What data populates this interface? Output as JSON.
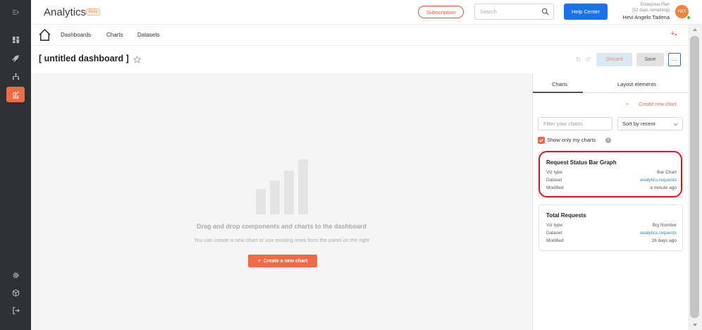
{
  "app": {
    "title": "Analytics",
    "badge": "Beta"
  },
  "header": {
    "subscription_label": "Subscription",
    "search_placeholder": "Search",
    "help_label": "Help Center",
    "plan_name": "Enterprise Plan",
    "plan_remaining": "(52 days remaining)",
    "user_name": "Hevi Angelo Tadena",
    "user_initials": "HAT"
  },
  "nav": {
    "links": [
      "Dashboards",
      "Charts",
      "Datasets"
    ],
    "add_symbol": "+"
  },
  "dashboard": {
    "title": "[ untitled dashboard ]",
    "discard_label": "Discard",
    "save_label": "Save",
    "more_label": "···"
  },
  "canvas": {
    "empty_title": "Drag and drop components and charts to the dashboard",
    "empty_subtitle": "You can create a new chart or use existing ones from the panel on the right",
    "create_button": "Create a new chart",
    "create_symbol": "+"
  },
  "panel": {
    "tabs": [
      "Charts",
      "Layout elements"
    ],
    "create_link": "Create new chart",
    "create_symbol": "+",
    "filter_placeholder": "Filter your charts",
    "sort_value": "Sort by recent",
    "checkbox_label": "Show only my charts",
    "info_symbol": "i",
    "cards": [
      {
        "title": "Request Status Bar Graph",
        "rows": [
          {
            "label": "Viz type",
            "value": "Bar Chart"
          },
          {
            "label": "Dataset",
            "value": "analytics.requests"
          },
          {
            "label": "Modified",
            "value": "a minute ago"
          }
        ]
      },
      {
        "title": "Total Requests",
        "rows": [
          {
            "label": "Viz type",
            "value": "Big Number"
          },
          {
            "label": "Dataset",
            "value": "analytics.requests"
          },
          {
            "label": "Modified",
            "value": "26 days ago"
          }
        ]
      }
    ]
  },
  "colors": {
    "accent": "#ef6a45",
    "primary_blue": "#1a73e8",
    "rail": "#2f3234",
    "highlight_red": "#e3141c",
    "link": "#2a8ac4"
  },
  "icons": {
    "rail_top": "menu-collapse-icon",
    "rail_items": [
      "dashboard-grid-icon",
      "rocket-icon",
      "hierarchy-icon",
      "analytics-chart-icon"
    ],
    "rail_bottom": [
      "settings-icon",
      "cube-icon",
      "logout-icon"
    ]
  }
}
